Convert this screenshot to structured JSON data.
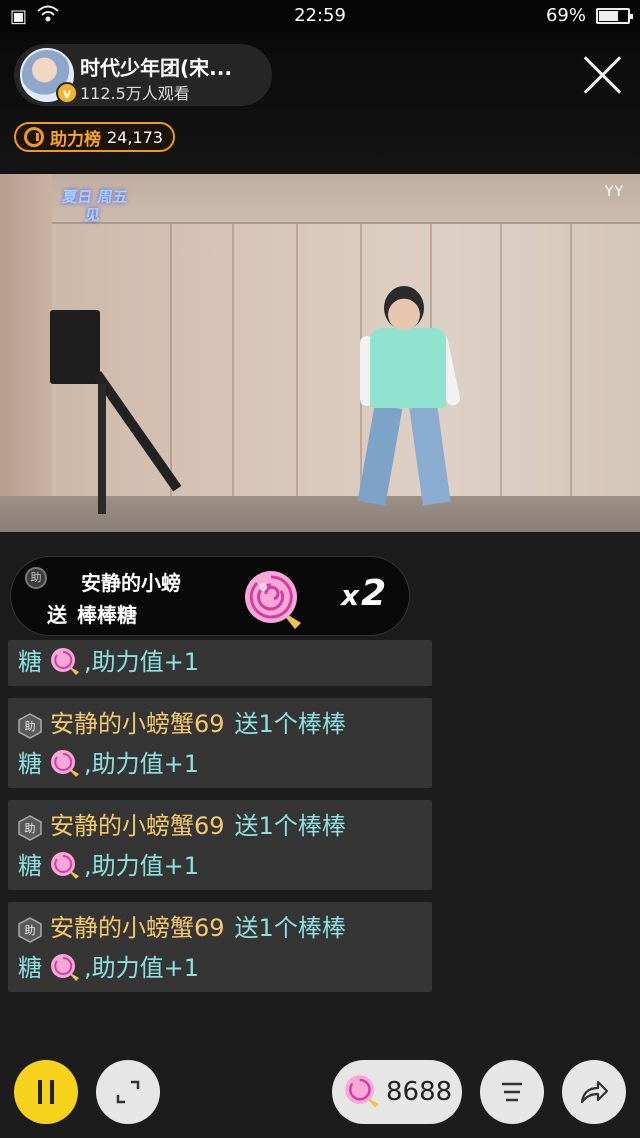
{
  "status_bar": {
    "time": "22:59",
    "battery": "69%",
    "battery_level": 0.69
  },
  "host": {
    "name": "时代少年团(宋...",
    "viewers": "112.5万人观看",
    "verified_badge": "v"
  },
  "rank": {
    "label": "助力榜",
    "value": "24,173"
  },
  "video": {
    "show_logo": "夏日 周五见",
    "watermark": "YY"
  },
  "gift_banner": {
    "badge": "助",
    "user": "安静的小螃",
    "action": "送",
    "gift_name": "棒棒糖",
    "multiplier": "2",
    "multiplier_prefix": "x"
  },
  "chat": {
    "partial": {
      "line2_start": "糖",
      "line2_end": ",助力值+1"
    },
    "messages": [
      {
        "user": "安静的小螃蟹69",
        "action": "送1个棒棒",
        "line2_start": "糖",
        "line2_end": ",助力值+1"
      },
      {
        "user": "安静的小螃蟹69",
        "action": "送1个棒棒",
        "line2_start": "糖",
        "line2_end": ",助力值+1"
      },
      {
        "user": "安静的小螃蟹69",
        "action": "送1个棒棒",
        "line2_start": "糖",
        "line2_end": ",助力值+1"
      }
    ]
  },
  "bottom_bar": {
    "gift_count": "8688"
  },
  "colors": {
    "accent": "#f7d21a",
    "rank_orange": "#f09a1c",
    "chat_user": "#f3c96b",
    "chat_text": "#8ee0e0"
  }
}
